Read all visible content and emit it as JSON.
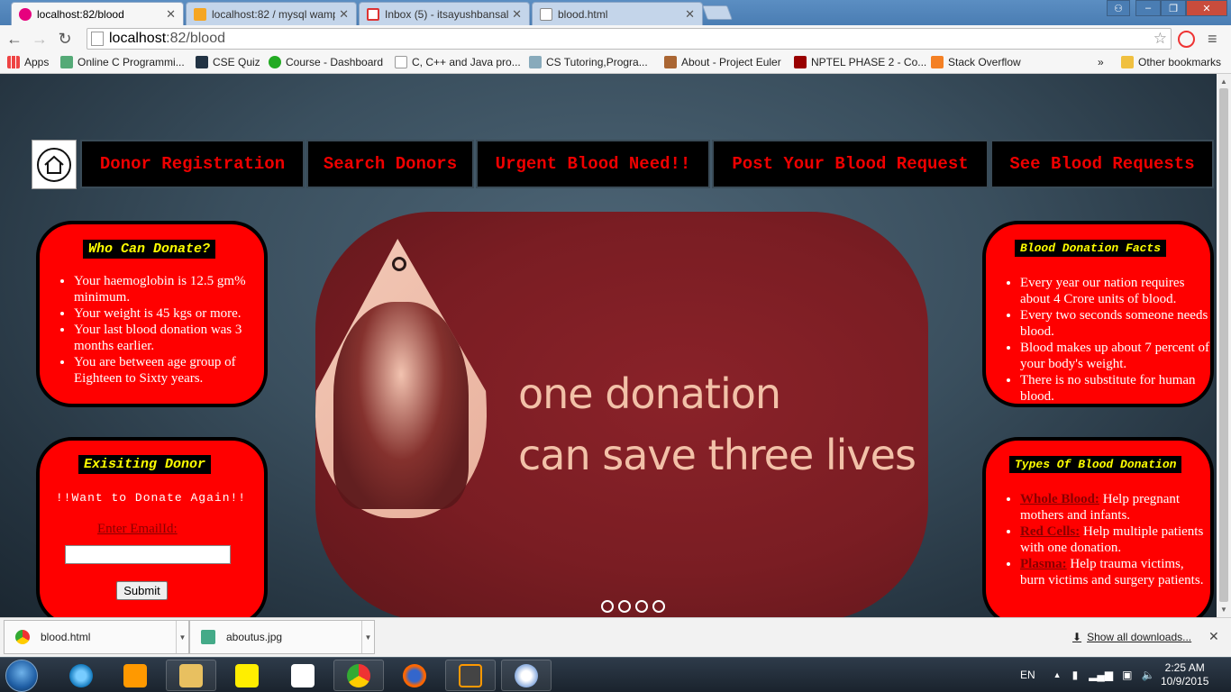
{
  "browser": {
    "tabs": [
      {
        "title": "localhost:82/blood",
        "active": true
      },
      {
        "title": "localhost:82 / mysql wamp",
        "active": false
      },
      {
        "title": "Inbox (5) - itsayushbansal",
        "active": false
      },
      {
        "title": "blood.html",
        "active": false
      }
    ],
    "url_host": "localhost",
    "url_rest": ":82/blood",
    "bookmarks": [
      "Apps",
      "Online C Programmi...",
      "CSE Quiz",
      "Course - Dashboard",
      "C, C++ and Java pro...",
      "CS Tutoring,Progra...",
      "About - Project Euler",
      "NPTEL PHASE 2 - Co...",
      "Stack Overflow"
    ],
    "bookmarks_more": "»",
    "other_bookmarks": "Other bookmarks"
  },
  "page": {
    "nav": [
      "Donor Registration",
      "Search Donors",
      "Urgent Blood Need!!",
      "Post Your Blood Request",
      "See Blood Requests"
    ],
    "who_can_donate": {
      "title": "Who Can Donate?",
      "items": [
        "Your haemoglobin is 12.5 gm% minimum.",
        "Your weight is 45 kgs or more.",
        "Your last blood donation was 3 months earlier.",
        "You are between age group of Eighteen to Sixty years."
      ]
    },
    "existing_donor": {
      "title": "Exisiting Donor",
      "subtitle": "!!Want to Donate Again!!",
      "email_label": "Enter EmailId:",
      "email_value": "",
      "submit_label": "Submit"
    },
    "slide": {
      "line1": "one donation",
      "line2": "can save three lives"
    },
    "facts": {
      "title": "Blood Donation Facts",
      "items": [
        "Every year our nation requires about 4 Crore units of blood.",
        "Every two seconds someone needs blood.",
        "Blood makes up about 7 percent of your body's weight.",
        "There is no substitute for human blood."
      ]
    },
    "types": {
      "title": "Types Of Blood Donation",
      "items": [
        {
          "term": "Whole Blood:",
          "desc": " Help pregnant mothers and infants."
        },
        {
          "term": "Red Cells:",
          "desc": " Help multiple patients with one donation."
        },
        {
          "term": "Plasma:",
          "desc": " Help trauma victims, burn victims and surgery patients."
        }
      ]
    }
  },
  "downloads": {
    "items": [
      "blood.html",
      "aboutus.jpg"
    ],
    "show_all": "Show all downloads..."
  },
  "taskbar": {
    "language": "EN",
    "time": "2:25 AM",
    "date": "10/9/2015"
  },
  "colors": {
    "panel_red": "#ff0000",
    "nav_text_red": "#e00000",
    "title_yellow": "#ffff00",
    "slide_maroon": "#7a1d23"
  }
}
